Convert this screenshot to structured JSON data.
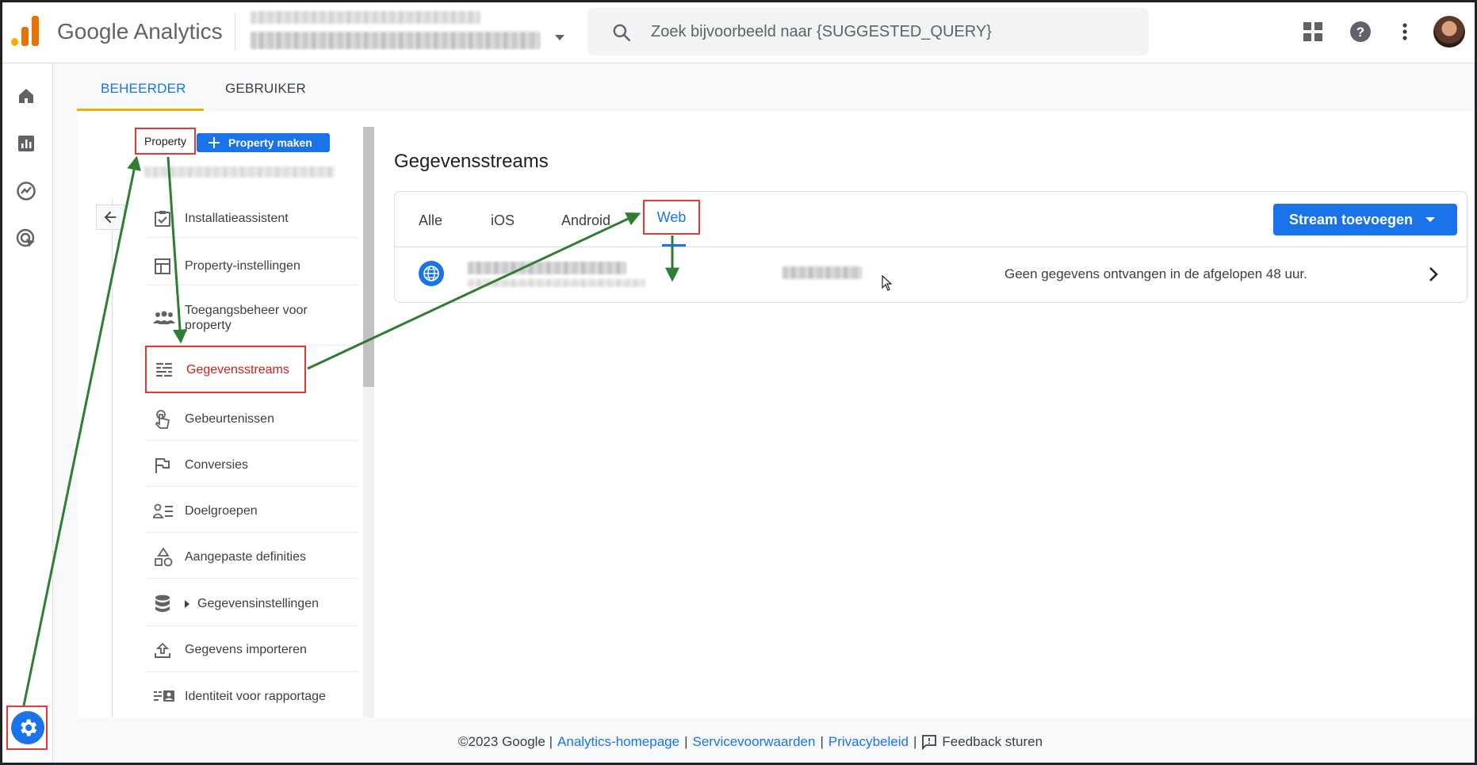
{
  "app": {
    "title": "Google Analytics"
  },
  "search": {
    "placeholder": "Zoek bijvoorbeeld naar {SUGGESTED_QUERY}"
  },
  "admin_tabs": {
    "admin": "BEHEERDER",
    "user": "GEBRUIKER"
  },
  "property": {
    "label": "Property",
    "create_button": "Property maken",
    "nav": [
      {
        "label": "Installatieassistent",
        "icon": "checklist-icon"
      },
      {
        "label": "Property-instellingen",
        "icon": "layout-icon"
      },
      {
        "label": "Toegangsbeheer voor property",
        "icon": "people-icon"
      },
      {
        "label": "Gegevensstreams",
        "icon": "streams-icon"
      },
      {
        "label": "Gebeurtenissen",
        "icon": "touch-icon"
      },
      {
        "label": "Conversies",
        "icon": "flag-icon"
      },
      {
        "label": "Doelgroepen",
        "icon": "audience-icon"
      },
      {
        "label": "Aangepaste definities",
        "icon": "shapes-icon"
      },
      {
        "label": "Gegevensinstellingen",
        "icon": "database-icon"
      },
      {
        "label": "Gegevens importeren",
        "icon": "upload-icon"
      },
      {
        "label": "Identiteit voor rapportage",
        "icon": "identity-icon"
      }
    ]
  },
  "streams": {
    "title": "Gegevensstreams",
    "tabs": [
      "Alle",
      "iOS",
      "Android",
      "Web"
    ],
    "active_tab": "Web",
    "add_button": "Stream toevoegen",
    "row": {
      "status": "Geen gegevens ontvangen in de afgelopen 48 uur."
    }
  },
  "footer": {
    "copyright": "©2023 Google |",
    "links": [
      "Analytics-homepage",
      "Servicevoorwaarden",
      "Privacybeleid"
    ],
    "separator": "|",
    "feedback": "Feedback sturen"
  },
  "colors": {
    "accent": "#1a73e8",
    "highlight": "#e53935",
    "arrow": "#2e7d32",
    "tab_indicator": "#f9ab00"
  }
}
